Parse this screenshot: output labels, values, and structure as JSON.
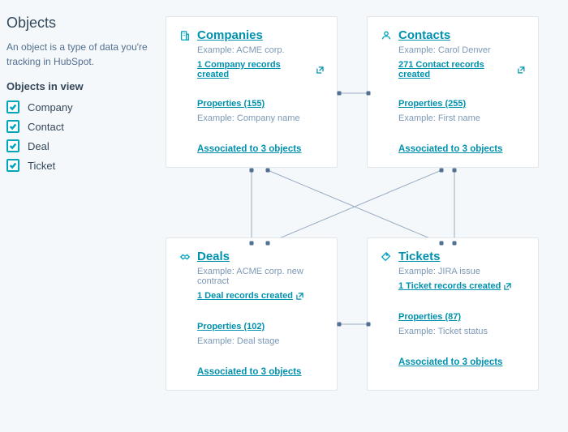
{
  "sidebar": {
    "title": "Objects",
    "description": "An object is a type of data you're tracking in HubSpot.",
    "section_title": "Objects in view",
    "items": [
      {
        "label": "Company"
      },
      {
        "label": "Contact"
      },
      {
        "label": "Deal"
      },
      {
        "label": "Ticket"
      }
    ]
  },
  "cards": [
    {
      "title": "Companies",
      "example": "Example: ACME corp.",
      "records_link": "1 Company records created",
      "properties_link": "Properties (155)",
      "properties_example": "Example: Company name",
      "associated_link": "Associated to 3 objects"
    },
    {
      "title": "Contacts",
      "example": "Example: Carol Denver",
      "records_link": "271 Contact records created",
      "properties_link": "Properties (255)",
      "properties_example": "Example: First name",
      "associated_link": "Associated to 3 objects"
    },
    {
      "title": "Deals",
      "example": "Example: ACME corp. new contract",
      "records_link": "1 Deal records created",
      "properties_link": "Properties (102)",
      "properties_example": "Example: Deal stage",
      "associated_link": "Associated to 3 objects"
    },
    {
      "title": "Tickets",
      "example": "Example: JIRA issue",
      "records_link": "1 Ticket records created",
      "properties_link": "Properties (87)",
      "properties_example": "Example: Ticket status",
      "associated_link": "Associated to 3 objects"
    }
  ]
}
